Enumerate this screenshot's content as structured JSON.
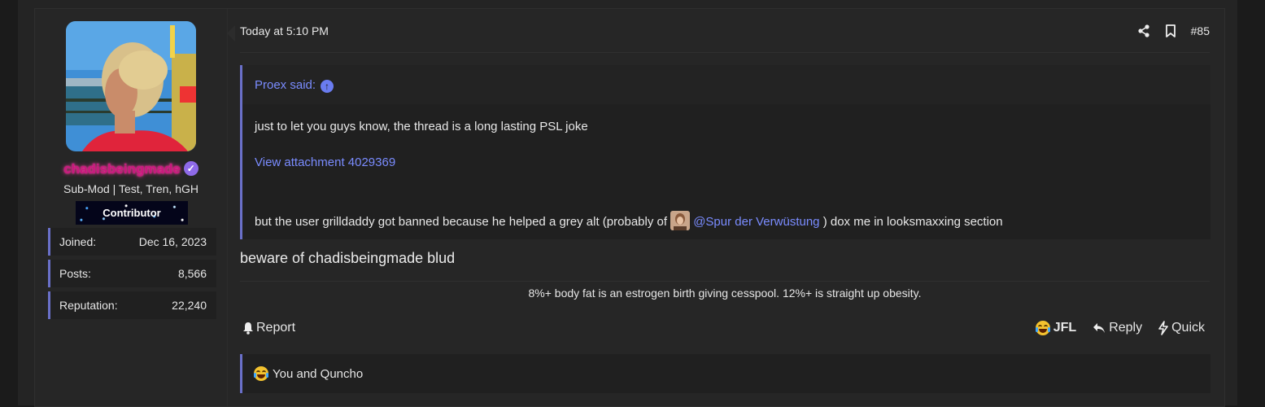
{
  "user": {
    "username": "chadisbeingmade",
    "title": "Sub-Mod | Test, Tren, hGH",
    "banner": "Contributor",
    "stats": [
      {
        "label": "Joined:",
        "value": "Dec 16, 2023"
      },
      {
        "label": "Posts:",
        "value": "8,566"
      },
      {
        "label": "Reputation:",
        "value": "22,240"
      }
    ]
  },
  "post": {
    "date": "Today at 5:10 PM",
    "number": "#85",
    "quote": {
      "author": "Proex said:",
      "line1": "just to let you guys know, the thread is a long lasting PSL joke",
      "attachment": "View attachment 4029369",
      "line3_before": "but the user grilldaddy got banned because he helped a grey alt (probably of",
      "mention": "@Spur der Verwüstung",
      "line3_after": ") dox me in looksmaxxing section"
    },
    "body": "beware of chadisbeingmade blud",
    "signature": "8%+ body fat is an estrogen birth giving cesspool. 12%+ is straight up obesity."
  },
  "actions": {
    "report": "Report",
    "jfl": "JFL",
    "reply": "Reply",
    "quick": "Quick"
  },
  "reactions": {
    "text": "You and Quncho"
  },
  "colors": {
    "accent": "#6a70c9",
    "link": "#7a8cff",
    "username": "#c9187e",
    "background": "#262626"
  }
}
